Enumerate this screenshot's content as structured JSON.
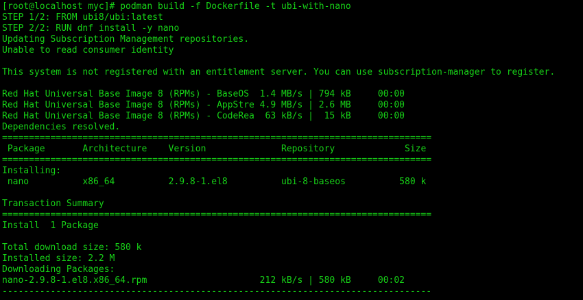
{
  "terminal": {
    "text_color": "#17d117",
    "background": "#000000",
    "lines": [
      "[root@localhost myc]# podman build -f Dockerfile -t ubi-with-nano",
      "STEP 1/2: FROM ubi8/ubi:latest",
      "STEP 2/2: RUN dnf install -y nano",
      "Updating Subscription Management repositories.",
      "Unable to read consumer identity",
      "",
      "This system is not registered with an entitlement server. You can use subscription-manager to register.",
      "",
      "Red Hat Universal Base Image 8 (RPMs) - BaseOS  1.4 MB/s | 794 kB     00:00",
      "Red Hat Universal Base Image 8 (RPMs) - AppStre 4.9 MB/s | 2.6 MB     00:00",
      "Red Hat Universal Base Image 8 (RPMs) - CodeRea  63 kB/s |  15 kB     00:00",
      "Dependencies resolved.",
      "================================================================================",
      " Package       Architecture    Version              Repository             Size",
      "================================================================================",
      "Installing:",
      " nano          x86_64          2.9.8-1.el8          ubi-8-baseos          580 k",
      "",
      "Transaction Summary",
      "================================================================================",
      "Install  1 Package",
      "",
      "Total download size: 580 k",
      "Installed size: 2.2 M",
      "Downloading Packages:",
      "nano-2.9.8-1.el8.x86_64.rpm                     212 kB/s | 580 kB     00:02",
      "--------------------------------------------------------------------------------"
    ]
  }
}
